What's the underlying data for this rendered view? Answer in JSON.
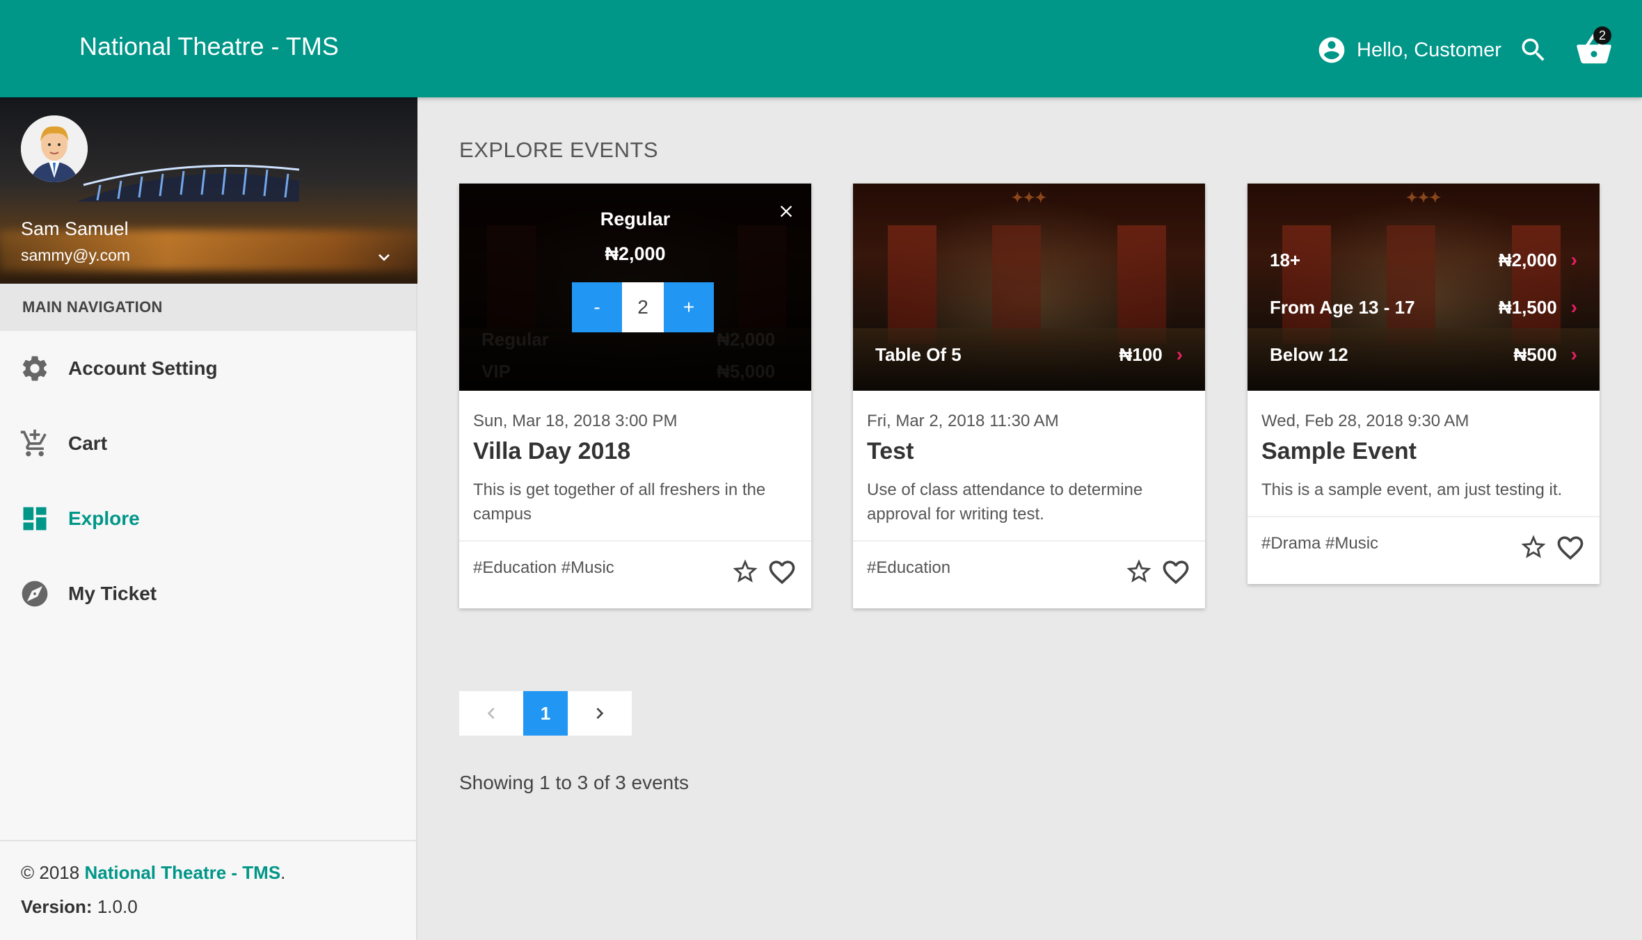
{
  "header": {
    "title": "National Theatre - TMS",
    "greeting": "Hello, Customer",
    "cart_count": "2"
  },
  "profile": {
    "name": "Sam Samuel",
    "email": "sammy@y.com"
  },
  "nav": {
    "header": "MAIN NAVIGATION",
    "items": [
      {
        "label": "Account Setting",
        "icon": "gear-icon"
      },
      {
        "label": "Cart",
        "icon": "cart-add-icon"
      },
      {
        "label": "Explore",
        "icon": "dashboard-icon",
        "active": true
      },
      {
        "label": "My Ticket",
        "icon": "compass-icon"
      }
    ]
  },
  "footer": {
    "copyright": "© 2018",
    "brand": "National Theatre - TMS",
    "period": ".",
    "version_label": "Version:",
    "version": "1.0.0"
  },
  "main": {
    "section_title": "EXPLORE EVENTS",
    "events": [
      {
        "date": "Sun, Mar 18, 2018 3:00 PM",
        "title": "Villa Day 2018",
        "description": "This is get together of all freshers in the campus",
        "tags": "#Education #Music",
        "ticket_types": [
          {
            "label": "Regular",
            "price": "₦2,000"
          },
          {
            "label": "VIP",
            "price": "₦5,000"
          }
        ],
        "selector": {
          "label": "Regular",
          "price": "₦2,000",
          "minus": "-",
          "quantity": "2",
          "plus": "+"
        }
      },
      {
        "date": "Fri, Mar 2, 2018 11:30 AM",
        "title": "Test",
        "description": "Use of class attendance to determine approval for writing test.",
        "tags": "#Education",
        "ticket_types": [
          {
            "label": "Table Of 5",
            "price": "₦100"
          }
        ]
      },
      {
        "date": "Wed, Feb 28, 2018 9:30 AM",
        "title": "Sample Event",
        "description": "This is a sample event, am just testing it.",
        "tags": "#Drama #Music",
        "ticket_types": [
          {
            "label": "18+",
            "price": "₦2,000"
          },
          {
            "label": "From Age 13 - 17",
            "price": "₦1,500"
          },
          {
            "label": "Below 12",
            "price": "₦500"
          }
        ]
      }
    ],
    "pagination": {
      "current": "1"
    },
    "showing": "Showing 1 to 3 of 3 events"
  },
  "colors": {
    "primary": "#009688",
    "accent": "#2196f3",
    "chevron": "#e91e63"
  }
}
